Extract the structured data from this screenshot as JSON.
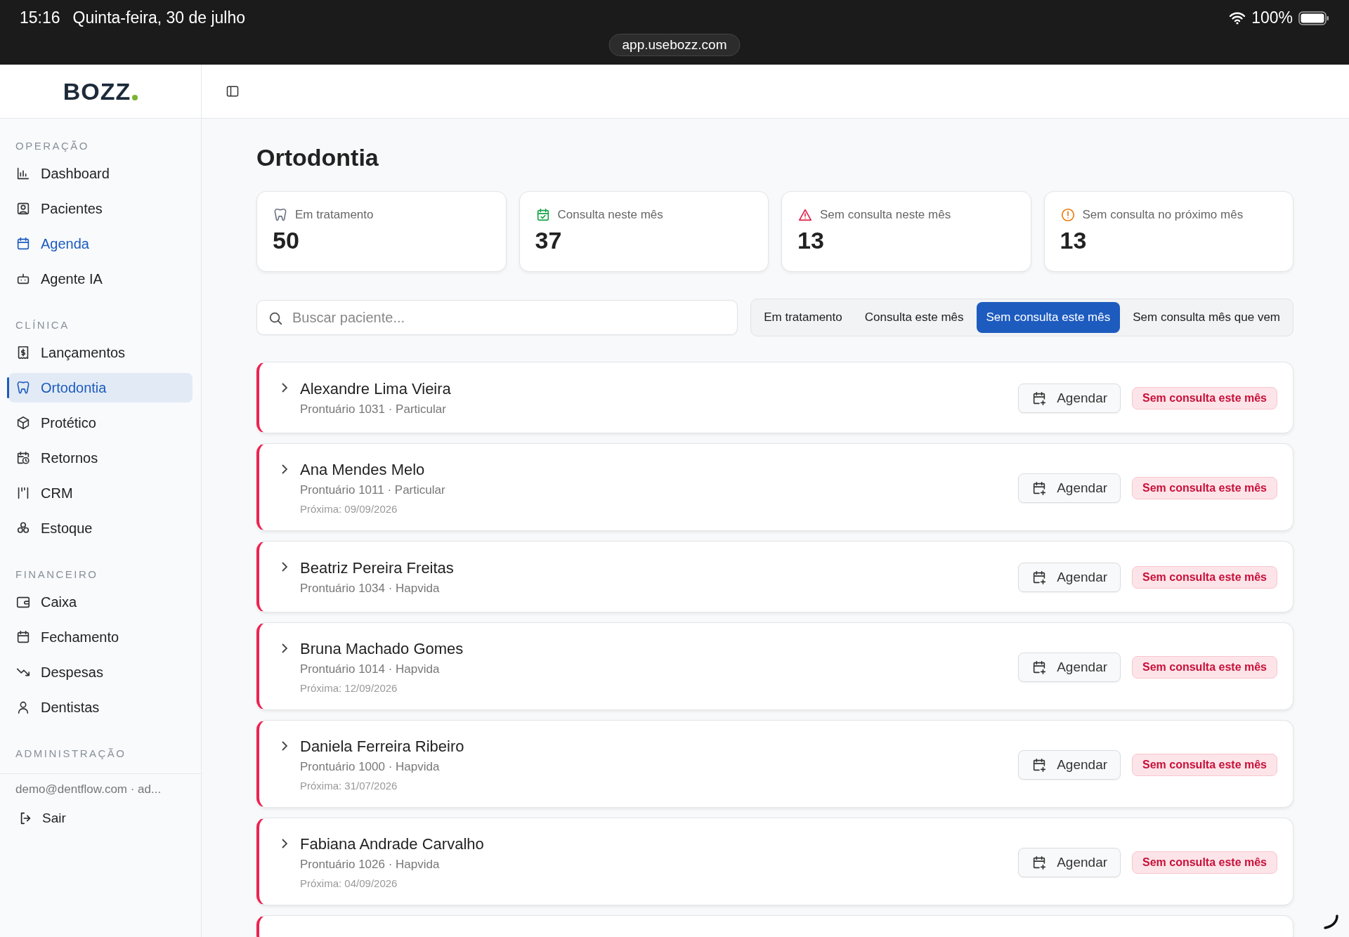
{
  "status_bar": {
    "time": "15:16",
    "date": "Quinta-feira, 30 de julho",
    "url": "app.usebozz.com",
    "battery": "100%"
  },
  "logo": "BOZZ",
  "sidebar": {
    "sections": [
      {
        "title": "OPERAÇÃO",
        "items": [
          {
            "label": "Dashboard",
            "kind": "chart",
            "selected": false,
            "highlighted": false
          },
          {
            "label": "Pacientes",
            "kind": "patient",
            "selected": false,
            "highlighted": false
          },
          {
            "label": "Agenda",
            "kind": "calendar",
            "selected": false,
            "highlighted": true
          },
          {
            "label": "Agente IA",
            "kind": "bot",
            "selected": false,
            "highlighted": false
          }
        ]
      },
      {
        "title": "CLÍNICA",
        "items": [
          {
            "label": "Lançamentos",
            "kind": "receipt",
            "selected": false,
            "highlighted": false
          },
          {
            "label": "Ortodontia",
            "kind": "tooth",
            "selected": true,
            "highlighted": false
          },
          {
            "label": "Protético",
            "kind": "box",
            "selected": false,
            "highlighted": false
          },
          {
            "label": "Retornos",
            "kind": "clock",
            "selected": false,
            "highlighted": false
          },
          {
            "label": "CRM",
            "kind": "crm",
            "selected": false,
            "highlighted": false
          },
          {
            "label": "Estoque",
            "kind": "stock",
            "selected": false,
            "highlighted": false
          }
        ]
      },
      {
        "title": "FINANCEIRO",
        "items": [
          {
            "label": "Caixa",
            "kind": "wallet",
            "selected": false,
            "highlighted": false
          },
          {
            "label": "Fechamento",
            "kind": "calendar",
            "selected": false,
            "highlighted": false
          },
          {
            "label": "Despesas",
            "kind": "trend",
            "selected": false,
            "highlighted": false
          },
          {
            "label": "Dentistas",
            "kind": "user",
            "selected": false,
            "highlighted": false
          }
        ]
      },
      {
        "title": "ADMINISTRAÇÃO"
      }
    ],
    "user": "demo@dentflow.com · ad...",
    "logout": "Sair"
  },
  "page": {
    "title": "Ortodontia"
  },
  "stats": [
    {
      "label": "Em tratamento",
      "value": "50",
      "kind": "tooth",
      "color": "#6b7280"
    },
    {
      "label": "Consulta neste mês",
      "value": "37",
      "kind": "calendar",
      "color": "#16a34a"
    },
    {
      "label": "Sem consulta neste mês",
      "value": "13",
      "kind": "warning",
      "color": "#e11d48"
    },
    {
      "label": "Sem consulta no próximo mês",
      "value": "13",
      "kind": "alert",
      "color": "#ea7a0c"
    }
  ],
  "search": {
    "placeholder": "Buscar paciente..."
  },
  "filters": [
    {
      "label": "Em tratamento",
      "selected": false
    },
    {
      "label": "Consulta este mês",
      "selected": false
    },
    {
      "label": "Sem consulta este mês",
      "selected": true
    },
    {
      "label": "Sem consulta mês que vem",
      "selected": false
    }
  ],
  "patients": [
    {
      "name": "Alexandre Lima Vieira",
      "record": "Prontuário 1031 · Particular",
      "action": "Agendar",
      "status": "Sem consulta este mês"
    },
    {
      "name": "Ana Mendes Melo",
      "record": "Prontuário 1011 · Particular",
      "next": "Próxima: 09/09/2026",
      "action": "Agendar",
      "status": "Sem consulta este mês"
    },
    {
      "name": "Beatriz Pereira Freitas",
      "record": "Prontuário 1034 · Hapvida",
      "action": "Agendar",
      "status": "Sem consulta este mês"
    },
    {
      "name": "Bruna Machado Gomes",
      "record": "Prontuário 1014 · Hapvida",
      "next": "Próxima: 12/09/2026",
      "action": "Agendar",
      "status": "Sem consulta este mês"
    },
    {
      "name": "Daniela Ferreira Ribeiro",
      "record": "Prontuário 1000 · Hapvida",
      "next": "Próxima: 31/07/2026",
      "action": "Agendar",
      "status": "Sem consulta este mês"
    },
    {
      "name": "Fabiana Andrade Carvalho",
      "record": "Prontuário 1026 · Hapvida",
      "next": "Próxima: 04/09/2026",
      "action": "Agendar",
      "status": "Sem consulta este mês"
    }
  ]
}
